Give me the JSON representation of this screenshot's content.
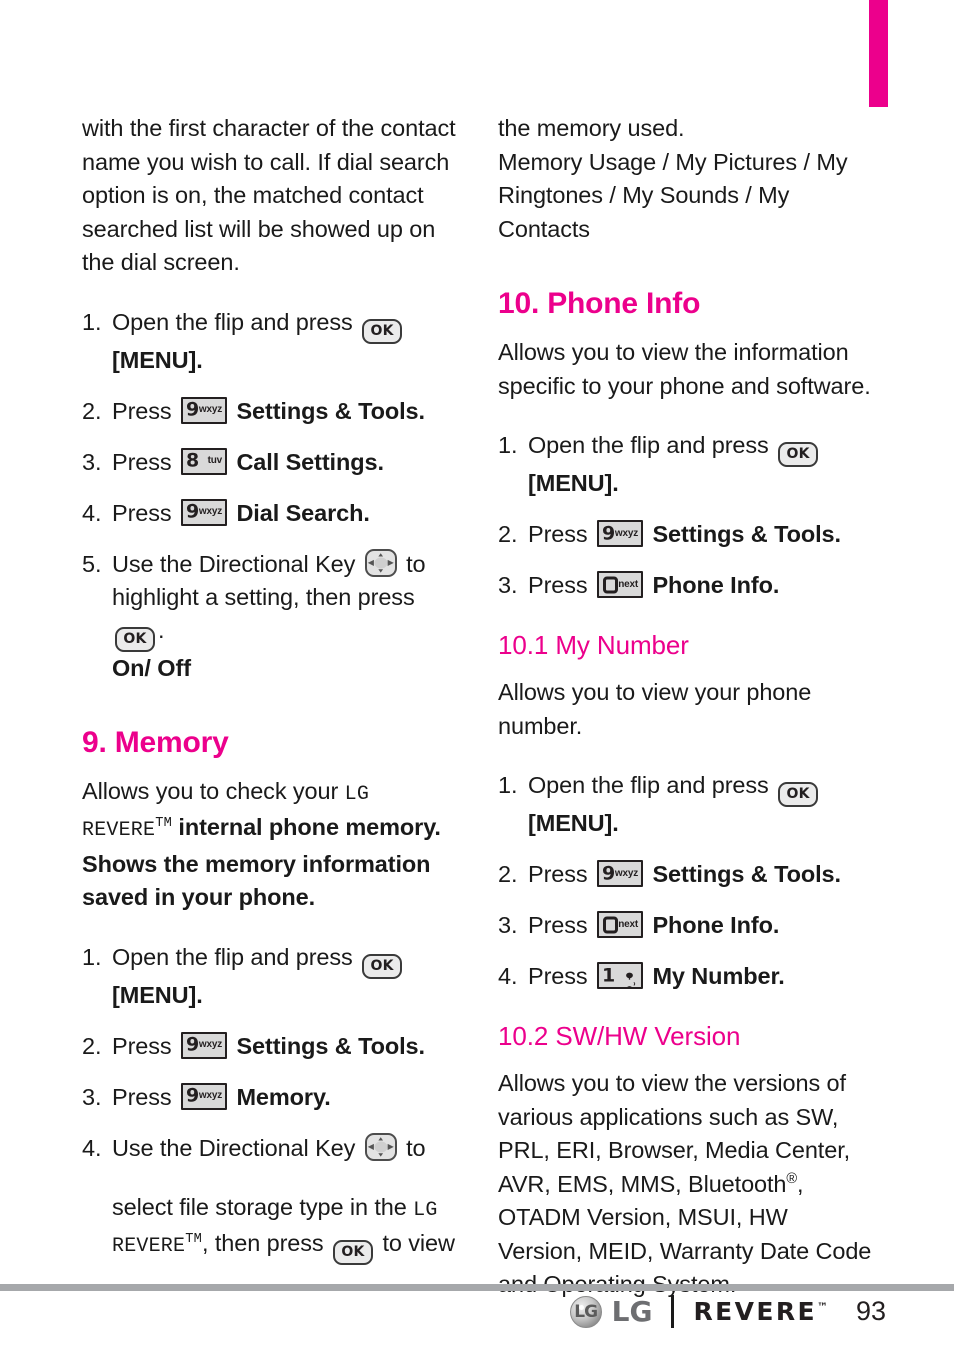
{
  "page": {
    "number": "93",
    "accent_color": "#ec008c",
    "footer_rule_color": "#a6a8ab"
  },
  "tab_marker": {
    "color": "#ec008c"
  },
  "left_column": {
    "intro_paragraph": "with the first character of the contact name you wish to call. If dial search option is on, the matched contact searched list will be showed up on the dial screen.",
    "dial_search_steps": [
      {
        "num": "1.",
        "pre": "Open the flip and press ",
        "key": "ok-key",
        "post": "",
        "bold_tail": "[MENU].",
        "tail_break": true
      },
      {
        "num": "2.",
        "pre": "Press ",
        "key": "9-wxyz-key",
        "post": "",
        "bold_tail": "Settings & Tools.",
        "tail_break": false
      },
      {
        "num": "3.",
        "pre": "Press ",
        "key": "8-tuv-key",
        "post": "",
        "bold_tail": "Call Settings.",
        "tail_break": false
      },
      {
        "num": "4.",
        "pre": "Press ",
        "key": "9-wxyz-key",
        "post": "",
        "bold_tail": "Dial Search.",
        "tail_break": false
      },
      {
        "num": "5.",
        "pre": "Use the Directional Key ",
        "key": "directional-key",
        "post": " to highlight a setting, then press ",
        "bold_tail": "On/ Off",
        "tail_break": true
      }
    ],
    "step5_ok_suffix": ".",
    "step5_options": "On/ Off",
    "memory_heading": "9. Memory",
    "memory_desc_part1": "Allows you to check your ",
    "memory_desc_lg": "LG REVERE",
    "memory_desc_tm": "TM",
    "memory_desc_part2": " internal phone memory. Shows the memory information saved in your phone.",
    "memory_steps": [
      {
        "num": "1.",
        "pre": "Open the flip and press ",
        "key": "ok-key",
        "bold_tail": "[MENU]."
      },
      {
        "num": "2.",
        "pre": "Press ",
        "key": "9-wxyz-key",
        "bold_tail": "Settings & Tools."
      },
      {
        "num": "3.",
        "pre": "Press ",
        "key": "9-wxyz-key",
        "bold_tail": "Memory."
      },
      {
        "num": "4.",
        "pre": "Use the Directional Key ",
        "key": "directional-key",
        "post": " to"
      }
    ],
    "memory_step4_cont_a": "select file storage type in the ",
    "memory_step4_lg": "LG REVERE",
    "memory_step4_tm": "TM",
    "memory_step4_cont_b": ", then press ",
    "memory_step4_cont_c": " to view"
  },
  "right_column": {
    "continued_line": "the memory used.",
    "memory_options": "Memory Usage / My Pictures / My Ringtones / My Sounds / My Contacts",
    "phone_info_heading": "10. Phone Info",
    "phone_info_desc": "Allows you to view the information specific to your phone and software.",
    "phone_info_steps": [
      {
        "num": "1.",
        "pre": "Open the flip and press ",
        "key": "ok-key",
        "bold_tail": "[MENU]."
      },
      {
        "num": "2.",
        "pre": "Press ",
        "key": "9-wxyz-key",
        "bold_tail": "Settings & Tools."
      },
      {
        "num": "3.",
        "pre": "Press ",
        "key": "0-next-key",
        "bold_tail": "Phone Info."
      }
    ],
    "my_number_heading": "10.1  My Number",
    "my_number_desc": "Allows you to view your phone number.",
    "my_number_steps": [
      {
        "num": "1.",
        "pre": "Open the flip and press ",
        "key": "ok-key",
        "bold_tail": "[MENU]."
      },
      {
        "num": "2.",
        "pre": "Press ",
        "key": "9-wxyz-key",
        "bold_tail": "Settings & Tools."
      },
      {
        "num": "3.",
        "pre": "Press ",
        "key": "0-next-key",
        "bold_tail": "Phone Info."
      },
      {
        "num": "4.",
        "pre": "Press ",
        "key": "1-voicemail-key",
        "bold_tail": "My Number."
      }
    ],
    "swhw_heading": "10.2  SW/HW Version",
    "swhw_desc_a": "Allows you to view the versions of various applications such as SW, PRL, ERI, Browser, Media Center, AVR, EMS, MMS, Bluetooth",
    "swhw_reg": "®",
    "swhw_desc_b": ", OTADM Version, MSUI, HW Version, MEID, Warranty Date Code and Operating System."
  },
  "keys": {
    "ok_label": "OK",
    "nine_digit": "9",
    "nine_letters": "wxyz",
    "eight_digit": "8",
    "eight_letters": "tuv",
    "zero_letters": "next",
    "one_digit": "1"
  },
  "footer": {
    "lg_mark": "LG",
    "lg_word": "LG",
    "revere_word": "REVERE",
    "revere_tm": "™",
    "page_number": "93"
  }
}
